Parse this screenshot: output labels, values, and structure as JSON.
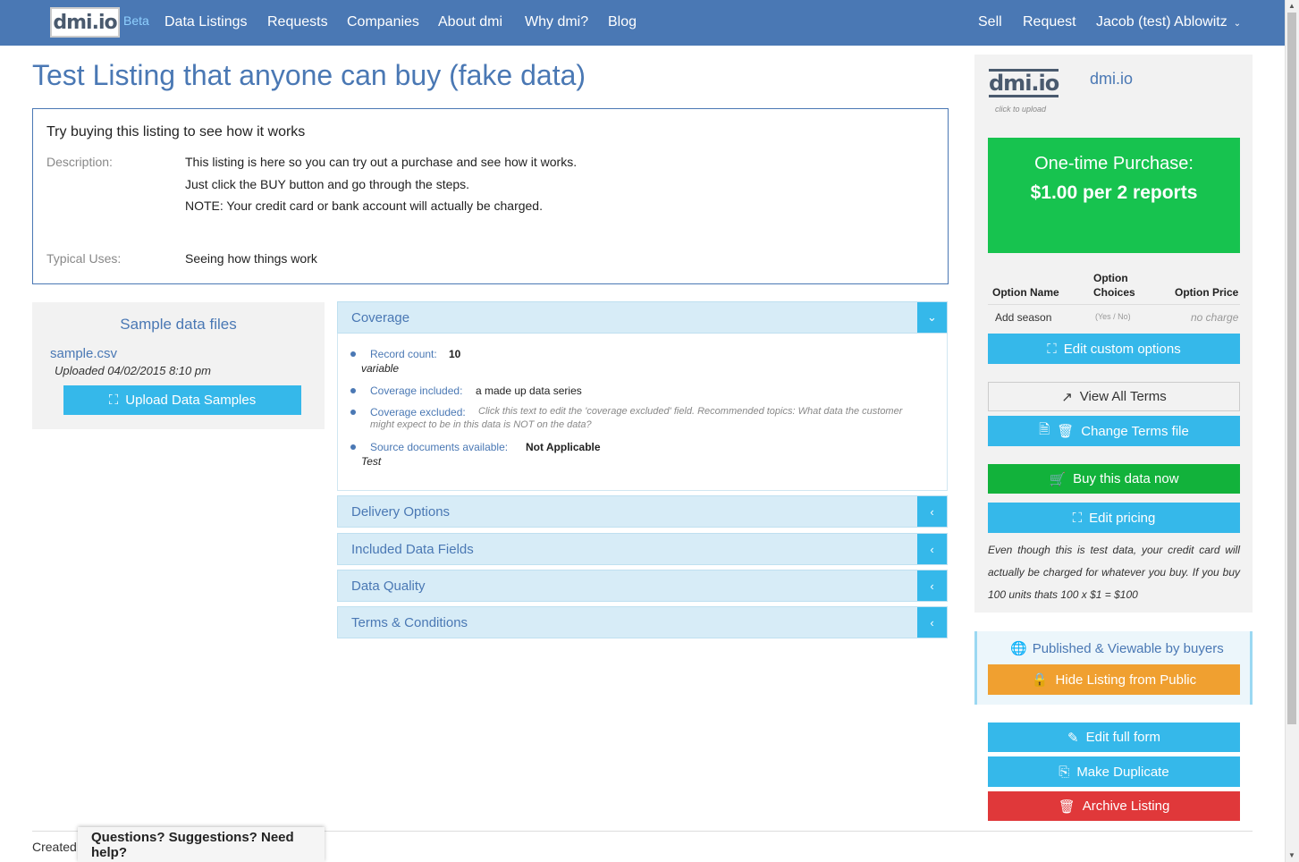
{
  "nav": {
    "logo": "dmi.io",
    "beta": "Beta",
    "links": [
      "Data Listings",
      "Requests",
      "Companies",
      "About dmi",
      "Why dmi?",
      "Blog"
    ],
    "right_links": [
      "Sell",
      "Request",
      "Jacob (test) Ablowitz"
    ]
  },
  "listing": {
    "title": "Test Listing that anyone can buy (fake data)",
    "heading": "Try buying this listing to see how it works",
    "description_label": "Description:",
    "description_lines": [
      "This listing is here so you can try out a purchase and see how it works.",
      "Just click the BUY button and go through the steps.",
      "NOTE: Your credit card or bank account will actually be charged."
    ],
    "typical_uses_label": "Typical Uses:",
    "typical_uses": "Seeing how things work"
  },
  "samples": {
    "title": "Sample data files",
    "file_name": "sample.csv",
    "uploaded": "Uploaded 04/02/2015 8:10 pm",
    "upload_button": "Upload Data Samples"
  },
  "coverage": {
    "title": "Coverage",
    "record_count_label": "Record count:",
    "record_count": "10",
    "record_count_note": "variable",
    "included_label": "Coverage included:",
    "included": "a made up data series",
    "excluded_label": "Coverage excluded:",
    "excluded_line1": "Click this text to edit the 'coverage excluded' field. Recommended topics: What data the customer",
    "excluded_line2": "might expect to be in this data is NOT on the data?",
    "source_label": "Source documents available:",
    "source": "Not Applicable",
    "source_note": "Test"
  },
  "sections": [
    "Delivery Options",
    "Included Data Fields",
    "Data Quality",
    "Terms & Conditions"
  ],
  "seller": {
    "logo": "dmi.io",
    "upload_hint": "click to upload",
    "company": "dmi.io"
  },
  "price": {
    "line1": "One-time Purchase:",
    "line2": "$1.00 per 2 reports"
  },
  "options": {
    "col_name": "Option Name",
    "col_choices_1": "Option",
    "col_choices_2": "Choices",
    "col_price": "Option Price",
    "row_name": "Add season",
    "row_choices": "(Yes / No)",
    "row_price": "no charge"
  },
  "buttons": {
    "edit_options": "Edit custom options",
    "view_terms": "View All Terms",
    "change_terms": "Change Terms file",
    "buy": "Buy this data now",
    "edit_pricing": "Edit pricing",
    "hide": "Hide Listing from Public",
    "edit_form": "Edit full form",
    "duplicate": "Make Duplicate",
    "archive": "Archive Listing"
  },
  "note": "Even though this is test data, your credit card will actually be charged for whatever you buy. If you buy 100 units thats 100 x $1 = $100",
  "status": "Published & Viewable by buyers",
  "footer": {
    "created": "Created",
    "help": "Questions? Suggestions? Need help?"
  },
  "colors": {
    "navbar": "#4a78b4",
    "accent_blue": "#35b8ea",
    "buy_green": "#12b23b",
    "price_green": "#17c34f",
    "orange": "#f0a030",
    "red": "#e0383a"
  }
}
